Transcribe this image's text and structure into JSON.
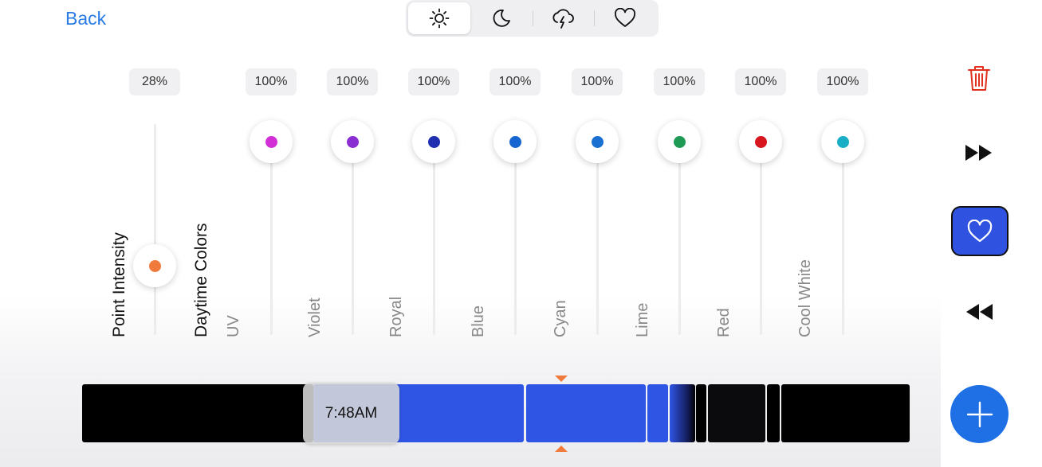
{
  "header": {
    "back_label": "Back",
    "modes": [
      {
        "name": "sun-icon",
        "active": true
      },
      {
        "name": "moon-icon",
        "active": false
      },
      {
        "name": "storm-icon",
        "active": false
      },
      {
        "name": "heart-icon",
        "active": false
      }
    ]
  },
  "intensity": {
    "label": "Point Intensity",
    "value_text": "28%",
    "value": 0.28,
    "color": "#f07a3c"
  },
  "colors_heading": "Daytime Colors",
  "channels": [
    {
      "label": "UV",
      "value_text": "100%",
      "value": 1.0,
      "color": "#d22fd6"
    },
    {
      "label": "Violet",
      "value_text": "100%",
      "value": 1.0,
      "color": "#8a2ed1"
    },
    {
      "label": "Royal",
      "value_text": "100%",
      "value": 1.0,
      "color": "#1f2fb0"
    },
    {
      "label": "Blue",
      "value_text": "100%",
      "value": 1.0,
      "color": "#1665d0"
    },
    {
      "label": "Cyan",
      "value_text": "100%",
      "value": 1.0,
      "color": "#1a70d1"
    },
    {
      "label": "Lime",
      "value_text": "100%",
      "value": 1.0,
      "color": "#1f9a55"
    },
    {
      "label": "Red",
      "value_text": "100%",
      "value": 1.0,
      "color": "#d8161e"
    },
    {
      "label": "Cool White",
      "value_text": "100%",
      "value": 1.0,
      "color": "#1aaec6"
    }
  ],
  "sidebar": {
    "icons": [
      "trash-icon",
      "fast-forward-icon",
      "heart-icon",
      "rewind-icon",
      "plus-icon"
    ]
  },
  "timeline": {
    "current_time": "7:48AM",
    "accent": "#2f55e4",
    "marker_color": "#f07a3c"
  }
}
